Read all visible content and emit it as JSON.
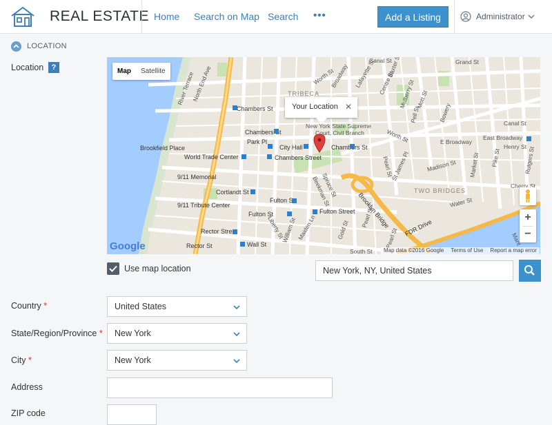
{
  "header": {
    "brand": "REAL ESTATE",
    "nav": [
      "Home",
      "Search on Map",
      "Search"
    ],
    "more": "•••",
    "add_listing": "Add a Listing",
    "user": "Administrator"
  },
  "section": {
    "title": "LOCATION"
  },
  "location_field": {
    "label": "Location",
    "help": "?"
  },
  "map": {
    "type_map": "Map",
    "type_satellite": "Satellite",
    "info_window": "Your Location",
    "close": "✕",
    "zoom_in": "+",
    "zoom_out": "−",
    "google": "Google",
    "attribution": [
      "Map data ©2016 Google",
      "Terms of Use",
      "Report a map error"
    ],
    "labels": {
      "tribeca": "TRIBECA",
      "two_bridges": "TWO BRIDGES",
      "canal_st": "Canal St",
      "canal_st_2": "Canal St",
      "grand_st": "Grand St",
      "chambers_st": "Chambers St",
      "chambers_st_2": "Chambers St",
      "chambers_st_3": "Chambers St",
      "chambers_street": "Chambers Street",
      "park_pl": "Park Pl",
      "city_hall": "City Hall",
      "brookfield_place": "Brookfield Place",
      "wtc": "World Trade Center",
      "memorial": "9/11 Memorial",
      "cortlandt": "Cortlandt St",
      "tribute": "9/11 Tribute Center",
      "fulton_st": "Fulton St",
      "fulton_st_2": "Fulton St",
      "fulton_street": "Fulton Street",
      "rector": "Rector Street",
      "rector_st": "Rector St",
      "wall_st": "Wall St",
      "south_st": "South St",
      "nys_supreme": "New York State Supreme",
      "civil_branch": "Court, Civil Branch",
      "fdr": "FDR Drive",
      "brooklyn_bridge": "Brooklyn Bridge",
      "east_broadway": "East Broadway",
      "e_broadway": "E Broadway",
      "madison": "Madison St",
      "water_st": "Water St",
      "cherry": "Cherry St",
      "henry": "Henry St",
      "pearl": "Pearl St",
      "worth": "Worth St",
      "worth_2": "Worth St",
      "north_end": "North End Ave",
      "river_terrace": "River Terrace",
      "broadway": "Broadway",
      "lafayette": "Lafayette St",
      "centre": "Centre St",
      "mott": "Mott St",
      "mulberry": "Mulberry St",
      "baxter": "Baxter St",
      "bowery": "Bowery",
      "pell": "Pell St",
      "market": "Market St",
      "pike": "Pike St",
      "rutgers": "Rutgers St",
      "james": "St James Pl",
      "pearl_2": "Pearl St",
      "spruce": "Spruce St",
      "beekman": "Beekman St",
      "william": "William St",
      "liberty": "Liberty St",
      "gold": "Gold St",
      "pearl_3": "Pearl St",
      "maiden": "Maiden Ln",
      "man": "Mant"
    }
  },
  "use_map_location": {
    "label": "Use map location",
    "checked": true
  },
  "location_search": {
    "value": "New York, NY, United States"
  },
  "country": {
    "label": "Country",
    "value": "United States",
    "required": "*"
  },
  "state": {
    "label": "State/Region/Province",
    "value": "New York",
    "required": "*"
  },
  "city": {
    "label": "City",
    "value": "New York",
    "required": "*"
  },
  "address": {
    "label": "Address",
    "value": ""
  },
  "zip": {
    "label": "ZIP code"
  },
  "colors": {
    "accent": "#3e92cc",
    "link": "#3d7fb8",
    "water": "#a3ccff",
    "highway": "#f5b94a"
  }
}
